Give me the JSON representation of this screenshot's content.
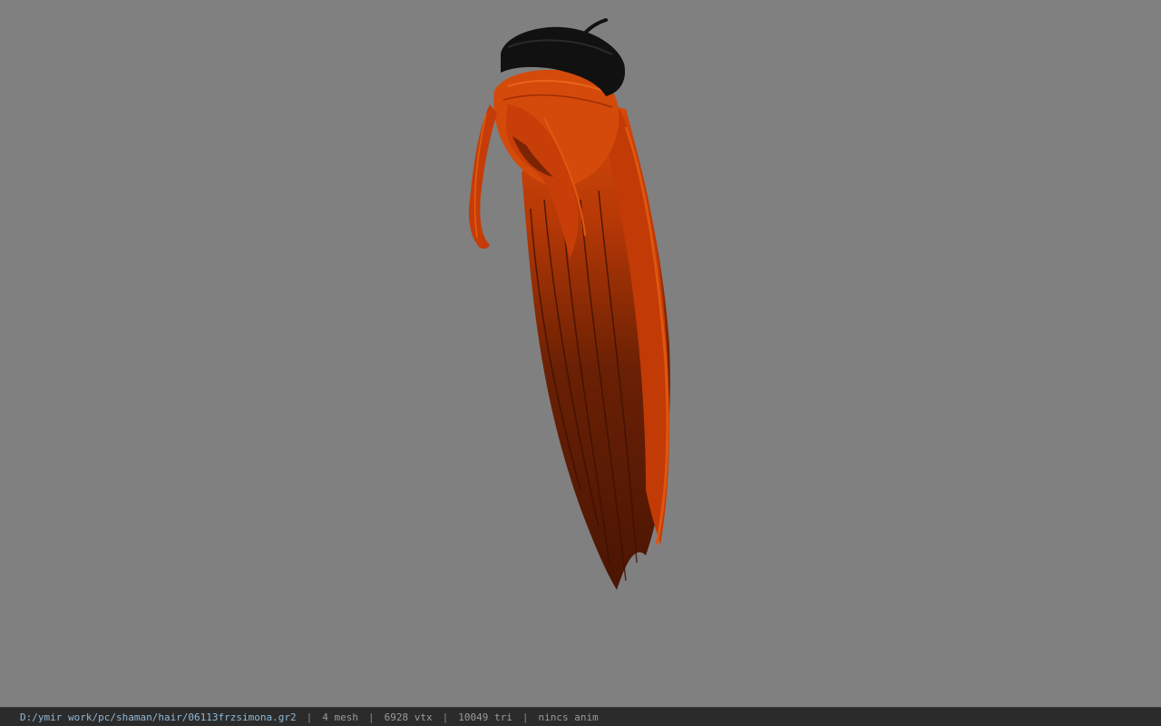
{
  "viewer": {
    "background_color": "#808080",
    "model": {
      "hair_color": "#c63a06",
      "hair_shadow_color": "#5a1a04",
      "hat_color": "#111111"
    }
  },
  "status": {
    "file_path": "D:/ymir work/pc/shaman/hair/06113frzsimona.gr2",
    "separator": "|",
    "mesh_count": "4 mesh",
    "vertex_count": "6928 vtx",
    "triangle_count": "10049 tri",
    "anim_status": "nincs anim"
  }
}
